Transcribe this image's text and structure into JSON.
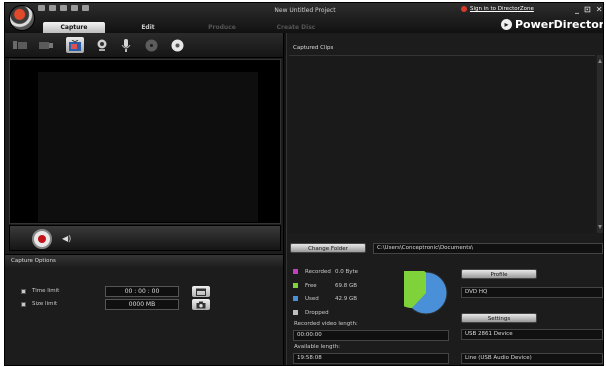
{
  "header": {
    "project_title": "New Untitled Project",
    "signin_text": "Sign in to DirectorZone",
    "brand": "PowerDirector",
    "window_controls": [
      "_",
      "⊡",
      "✕"
    ],
    "tabs": [
      {
        "label": "Capture",
        "state": "active"
      },
      {
        "label": "Edit",
        "state": "normal"
      },
      {
        "label": "Produce",
        "state": "disabled"
      },
      {
        "label": "Create Disc",
        "state": "disabled"
      }
    ]
  },
  "toolbar": {
    "icons": [
      "dv-camcorder-icon",
      "hdv-camcorder-icon",
      "tv-icon",
      "webcam-icon",
      "microphone-icon",
      "cd-icon",
      "dvd-icon"
    ],
    "active_index": 2
  },
  "playback": {
    "record_icon": "record-icon",
    "volume_icon": "volume-icon"
  },
  "capture_options": {
    "heading": "Capture Options",
    "time_limit_label": "Time limit",
    "time_limit_value": "00 : 00 : 00",
    "size_limit_label": "Size limit",
    "size_limit_value": "0000   MB"
  },
  "clips": {
    "heading": "Captured Clips"
  },
  "folder": {
    "button_label": "Change Folder",
    "path": "C:\\Users\\Conceptronic\\Documents\\"
  },
  "disk": {
    "rows": [
      {
        "label": "Recorded",
        "value": "0.0  Byte",
        "color": "#c040c0"
      },
      {
        "label": "Free",
        "value": "69.8  GB",
        "color": "#7fd23a"
      },
      {
        "label": "Used",
        "value": "42.9  GB",
        "color": "#4a90d9"
      },
      {
        "label": "Dropped",
        "value": "",
        "color": "#bfbfbf"
      }
    ],
    "free_fraction": 0.62,
    "recorded_length_label": "Recorded video length:",
    "recorded_length_value": "00:00:00",
    "available_length_label": "Available length:",
    "available_length_value": "19:58:08"
  },
  "profile": {
    "button_label": "Profile",
    "value": "DVD HQ",
    "settings_label": "Settings",
    "device": "USB 2861 Device",
    "audio_device": "Line (USB Audio Device)"
  }
}
